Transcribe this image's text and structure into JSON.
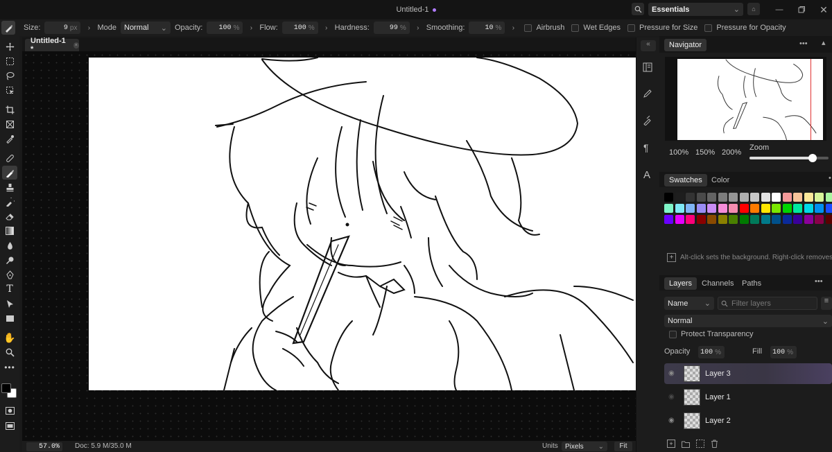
{
  "window": {
    "title": "Untitled-1",
    "workspace": "Essentials"
  },
  "options": {
    "size_label": "Size:",
    "size_value": "9",
    "size_unit": "px",
    "mode_label": "Mode",
    "mode_value": "Normal",
    "opacity_label": "Opacity:",
    "opacity_value": "100",
    "opacity_unit": "%",
    "flow_label": "Flow:",
    "flow_value": "100",
    "flow_unit": "%",
    "hardness_label": "Hardness:",
    "hardness_value": "99",
    "hardness_unit": "%",
    "smoothing_label": "Smoothing:",
    "smoothing_value": "10",
    "smoothing_unit": "%",
    "airbrush": "Airbrush",
    "wet_edges": "Wet Edges",
    "pressure_size": "Pressure for Size",
    "pressure_opacity": "Pressure for Opacity"
  },
  "document_tab": {
    "label": "Untitled-1 *"
  },
  "status": {
    "zoom": "57.0%",
    "doc": "Doc: 5.9 M/35.0 M",
    "units_label": "Units",
    "units_value": "Pixels",
    "fit": "Fit"
  },
  "navigator": {
    "title": "Navigator",
    "zoom_100": "100%",
    "zoom_150": "150%",
    "zoom_200": "200%",
    "zoom_label": "Zoom",
    "zoom_level": 0.8
  },
  "swatches": {
    "tab_swatches": "Swatches",
    "tab_color": "Color",
    "hint": "Alt-click sets the background. Right-click removes",
    "colors": [
      "#000000",
      "#1e1e1e",
      "#333333",
      "#4a4a4a",
      "#636363",
      "#7c7c7c",
      "#959595",
      "#afafaf",
      "#c8c8c8",
      "#e2e2e2",
      "#ffffff",
      "#f49a9a",
      "#f8c49a",
      "#fbe89a",
      "#d8f59a",
      "#a8f5a0",
      "#7ff5c8",
      "#7fe8f5",
      "#7fb4f5",
      "#9a8cf5",
      "#c98cf5",
      "#f58cd8",
      "#f58caf",
      "#ff0000",
      "#ff7a00",
      "#ffe600",
      "#7ae600",
      "#00d400",
      "#00e8a0",
      "#00d8e8",
      "#0090f0",
      "#1a4dff",
      "#6a00ff",
      "#e600ff",
      "#ff007a",
      "#8a0000",
      "#8a4a00",
      "#8a8000",
      "#4a8000",
      "#007a00",
      "#007a5a",
      "#007a8a",
      "#00508a",
      "#0a2a9a",
      "#3a009a",
      "#8a009a",
      "#8a004a",
      "#5a0000"
    ]
  },
  "layers": {
    "tab_layers": "Layers",
    "tab_channels": "Channels",
    "tab_paths": "Paths",
    "filter_kind": "Name",
    "filter_placeholder": "Filter layers",
    "blend_mode": "Normal",
    "protect": "Protect Transparency",
    "opacity_label": "Opacity",
    "opacity_value": "100",
    "fill_label": "Fill",
    "fill_value": "100",
    "pct": "%",
    "items": [
      {
        "name": "Layer 3",
        "selected": true,
        "visible": true
      },
      {
        "name": "Layer 1",
        "selected": false,
        "visible": false
      },
      {
        "name": "Layer 2",
        "selected": false,
        "visible": true
      }
    ]
  },
  "colors": {
    "accent": "#b07cff",
    "selected_layer": "#3a3645",
    "canvas_bg": "#0c0c0c"
  }
}
